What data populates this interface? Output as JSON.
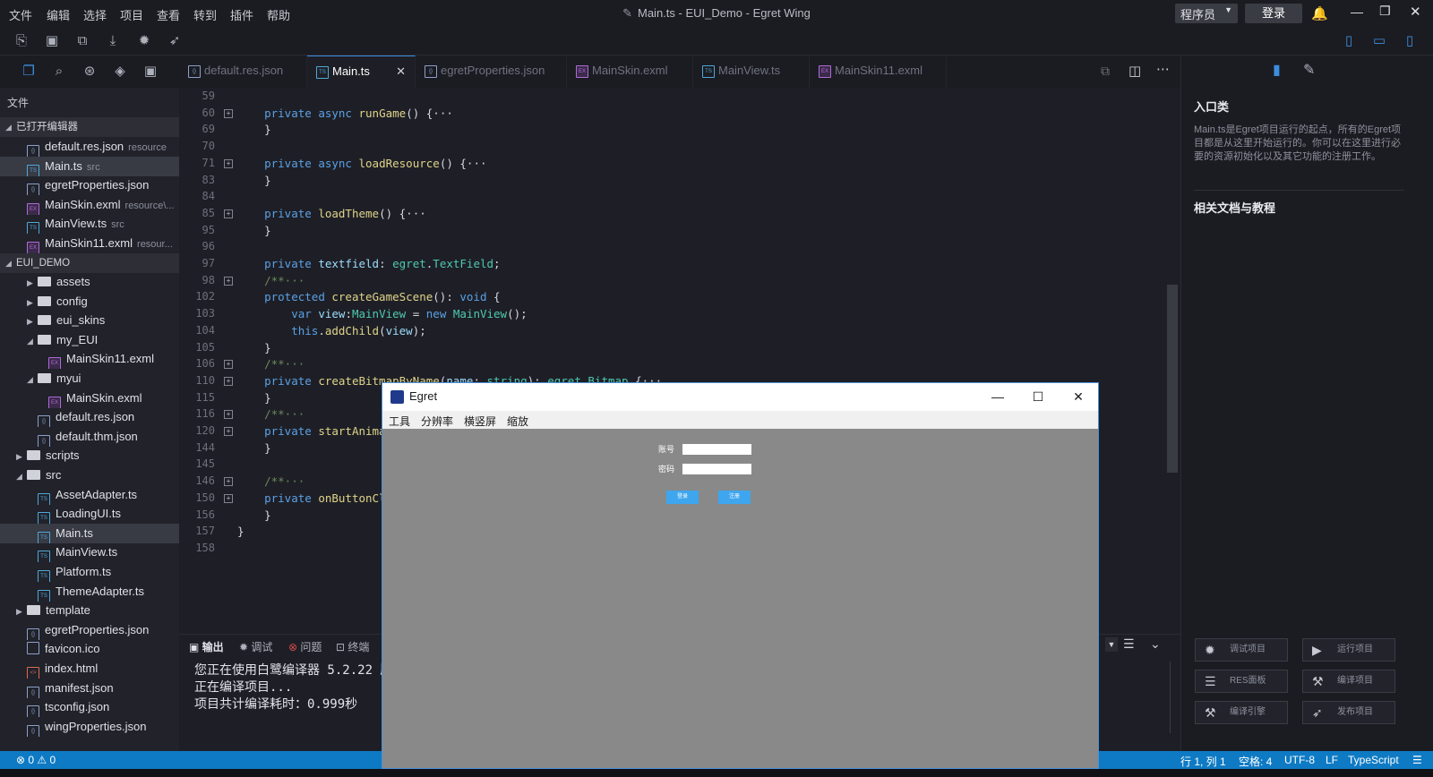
{
  "window": {
    "title": "Main.ts - EUI_Demo - Egret Wing"
  },
  "menu": [
    "文件",
    "编辑",
    "选择",
    "项目",
    "查看",
    "转到",
    "插件",
    "帮助"
  ],
  "account": {
    "role": "程序员",
    "login_label": "登录"
  },
  "sidebar": {
    "header": "文件",
    "open_editors_title": "已打开编辑器",
    "open_editors": [
      {
        "name": "default.res.json",
        "hint": "resource",
        "type": "json"
      },
      {
        "name": "Main.ts",
        "hint": "src",
        "type": "ts"
      },
      {
        "name": "egretProperties.json",
        "hint": "",
        "type": "json"
      },
      {
        "name": "MainSkin.exml",
        "hint": "resource\\...",
        "type": "exml"
      },
      {
        "name": "MainView.ts",
        "hint": "src",
        "type": "ts"
      },
      {
        "name": "MainSkin11.exml",
        "hint": "resour...",
        "type": "exml"
      }
    ],
    "project_title": "EUI_DEMO",
    "tree": [
      {
        "name": "assets",
        "kind": "folder",
        "depth": 1,
        "state": "closed"
      },
      {
        "name": "config",
        "kind": "folder",
        "depth": 1,
        "state": "closed"
      },
      {
        "name": "eui_skins",
        "kind": "folder",
        "depth": 1,
        "state": "closed"
      },
      {
        "name": "my_EUI",
        "kind": "folder",
        "depth": 1,
        "state": "open"
      },
      {
        "name": "MainSkin11.exml",
        "kind": "exml",
        "depth": 2
      },
      {
        "name": "myui",
        "kind": "folder",
        "depth": 1,
        "state": "open"
      },
      {
        "name": "MainSkin.exml",
        "kind": "exml",
        "depth": 2
      },
      {
        "name": "default.res.json",
        "kind": "json",
        "depth": 1
      },
      {
        "name": "default.thm.json",
        "kind": "json",
        "depth": 1
      },
      {
        "name": "scripts",
        "kind": "folder",
        "depth": 0,
        "state": "closed"
      },
      {
        "name": "src",
        "kind": "folder",
        "depth": 0,
        "state": "open"
      },
      {
        "name": "AssetAdapter.ts",
        "kind": "ts",
        "depth": 1
      },
      {
        "name": "LoadingUI.ts",
        "kind": "ts",
        "depth": 1
      },
      {
        "name": "Main.ts",
        "kind": "ts",
        "depth": 1,
        "selected": true
      },
      {
        "name": "MainView.ts",
        "kind": "ts",
        "depth": 1
      },
      {
        "name": "Platform.ts",
        "kind": "ts",
        "depth": 1
      },
      {
        "name": "ThemeAdapter.ts",
        "kind": "ts",
        "depth": 1
      },
      {
        "name": "template",
        "kind": "folder",
        "depth": 0,
        "state": "closed"
      },
      {
        "name": "egretProperties.json",
        "kind": "json",
        "depth": 0
      },
      {
        "name": "favicon.ico",
        "kind": "file",
        "depth": 0
      },
      {
        "name": "index.html",
        "kind": "html",
        "depth": 0
      },
      {
        "name": "manifest.json",
        "kind": "json",
        "depth": 0
      },
      {
        "name": "tsconfig.json",
        "kind": "json",
        "depth": 0
      },
      {
        "name": "wingProperties.json",
        "kind": "json",
        "depth": 0
      }
    ]
  },
  "tabs": [
    {
      "label": "default.res.json",
      "type": "json",
      "active": false
    },
    {
      "label": "Main.ts",
      "type": "ts",
      "active": true
    },
    {
      "label": "egretProperties.json",
      "type": "json",
      "active": false
    },
    {
      "label": "MainSkin.exml",
      "type": "exml",
      "active": false
    },
    {
      "label": "MainView.ts",
      "type": "ts",
      "active": false
    },
    {
      "label": "MainSkin11.exml",
      "type": "exml",
      "active": false
    }
  ],
  "editor": {
    "lines": [
      {
        "n": "59",
        "fold": false,
        "html": ""
      },
      {
        "n": "60",
        "fold": true,
        "html": "    <span class='kw'>private</span> <span class='kw'>async</span> <span class='fn'>runGame</span>() {···"
      },
      {
        "n": "69",
        "fold": false,
        "html": "    }"
      },
      {
        "n": "70",
        "fold": false,
        "html": ""
      },
      {
        "n": "71",
        "fold": true,
        "html": "    <span class='kw'>private</span> <span class='kw'>async</span> <span class='fn'>loadResource</span>() {···"
      },
      {
        "n": "83",
        "fold": false,
        "html": "    }"
      },
      {
        "n": "84",
        "fold": false,
        "html": ""
      },
      {
        "n": "85",
        "fold": true,
        "html": "    <span class='kw'>private</span> <span class='fn'>loadTheme</span>() {···"
      },
      {
        "n": "95",
        "fold": false,
        "html": "    }"
      },
      {
        "n": "96",
        "fold": false,
        "html": ""
      },
      {
        "n": "97",
        "fold": false,
        "html": "    <span class='kw'>private</span> <span class='var'>textfield</span>: <span class='ty'>egret</span>.<span class='ty'>TextField</span>;"
      },
      {
        "n": "98",
        "fold": true,
        "html": "    <span class='cm'>/**···</span>"
      },
      {
        "n": "102",
        "fold": false,
        "html": "    <span class='kw'>protected</span> <span class='fn'>createGameScene</span>(): <span class='kw'>void</span> {"
      },
      {
        "n": "103",
        "fold": false,
        "html": "        <span class='kw'>var</span> <span class='var'>view</span>:<span class='ty'>MainView</span> = <span class='kw'>new</span> <span class='ty'>MainView</span>();"
      },
      {
        "n": "104",
        "fold": false,
        "html": "        <span class='kw'>this</span>.<span class='fn'>addChild</span>(<span class='var'>view</span>);"
      },
      {
        "n": "105",
        "fold": false,
        "html": "    }"
      },
      {
        "n": "106",
        "fold": true,
        "html": "    <span class='cm'>/**···</span>"
      },
      {
        "n": "110",
        "fold": true,
        "html": "    <span class='kw'>private</span> <span class='fn'>createBitmapByName</span>(<span class='var'>name</span>: <span class='ty'>string</span>): <span class='ty'>egret</span>.<span class='ty'>Bitmap</span> {···"
      },
      {
        "n": "115",
        "fold": false,
        "html": "    }"
      },
      {
        "n": "116",
        "fold": true,
        "html": "    <span class='cm'>/**···</span>"
      },
      {
        "n": "120",
        "fold": true,
        "html": "    <span class='kw'>private</span> <span class='fn'>startAnimation</span>"
      },
      {
        "n": "144",
        "fold": false,
        "html": "    }"
      },
      {
        "n": "145",
        "fold": false,
        "html": ""
      },
      {
        "n": "146",
        "fold": true,
        "html": "    <span class='cm'>/**···</span>"
      },
      {
        "n": "150",
        "fold": true,
        "html": "    <span class='kw'>private</span> <span class='fn'>onButtonClick</span>"
      },
      {
        "n": "156",
        "fold": false,
        "html": "    }"
      },
      {
        "n": "157",
        "fold": false,
        "html": "}"
      },
      {
        "n": "158",
        "fold": false,
        "html": ""
      }
    ]
  },
  "panel": {
    "tabs": [
      "输出",
      "调试",
      "问题",
      "终端"
    ],
    "output": [
      "您正在使用白鹭编译器 5.2.22 版本",
      "正在编译项目...",
      "项目共计编译耗时：0.999秒"
    ]
  },
  "right_panel": {
    "title": "入口类",
    "description": "Main.ts是Egret项目运行的起点，所有的Egret项目都是从这里开始运行的。你可以在这里进行必要的资源初始化以及其它功能的注册工作。",
    "docs_title": "相关文档与教程",
    "buttons": [
      "调试项目",
      "运行项目",
      "RES面板",
      "编译项目",
      "编译引擎",
      "发布项目"
    ]
  },
  "statusbar": {
    "errors": "0",
    "warnings": "0",
    "position": "行 1, 列 1",
    "indent": "空格: 4",
    "encoding": "UTF-8",
    "eol": "LF",
    "language": "TypeScript"
  },
  "egret_window": {
    "title": "Egret",
    "menu": [
      "工具",
      "分辨率",
      "横竖屏",
      "缩放"
    ],
    "account_label": "账号",
    "password_label": "密码",
    "login_btn": "登录",
    "register_btn": "注册"
  },
  "colors": {
    "accent": "#0e7ac4",
    "modal_bg": "#898989",
    "button_blue": "#3ea6ee"
  }
}
